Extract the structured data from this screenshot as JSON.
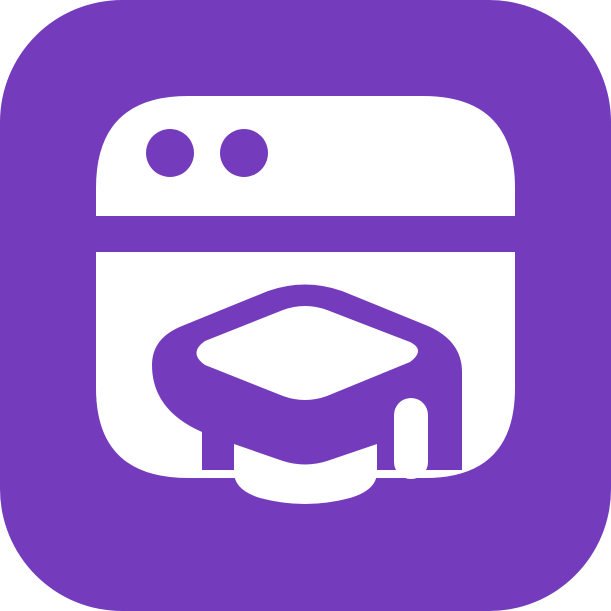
{
  "icon": {
    "name": "online-education-app-icon",
    "symbol": "browser-window-with-graduation-cap",
    "colors": {
      "background": "#743cbc",
      "glyph": "#ffffff"
    }
  }
}
